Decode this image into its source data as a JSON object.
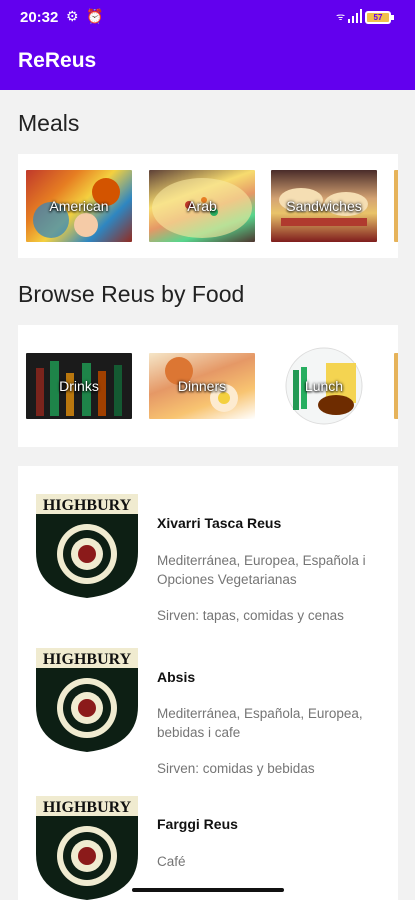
{
  "status_bar": {
    "time": "20:32",
    "icons": [
      "settings-gear-icon",
      "alarm-icon",
      "wifi-icon",
      "signal-icon"
    ],
    "battery": "57"
  },
  "app_bar": {
    "title": "ReReus"
  },
  "meals": {
    "title": "Meals",
    "items": [
      {
        "label": "American",
        "image": "american-food-photo"
      },
      {
        "label": "Arab",
        "image": "arab-rice-dish-photo"
      },
      {
        "label": "Sandwiches",
        "image": "sandwiches-photo"
      }
    ]
  },
  "browse": {
    "title": "Browse Reus by Food",
    "items": [
      {
        "label": "Drinks",
        "image": "drink-bottles-photo"
      },
      {
        "label": "Dinners",
        "image": "dinner-table-photo"
      },
      {
        "label": "Lunch",
        "image": "lunch-plate-photo"
      }
    ]
  },
  "restaurants": [
    {
      "name": "Xivarri Tasca Reus",
      "cuisine": "Mediterránea, Europea, Española i Opciones Vegetarianas",
      "serve": "Sirven: tapas, comidas y cenas",
      "logo_text": "HIGHBURY"
    },
    {
      "name": "Absis",
      "cuisine": "Mediterránea, Española, Europea, bebidas i cafe",
      "serve": "Sirven: comidas y bebidas",
      "logo_text": "HIGHBURY"
    },
    {
      "name": "Farggi Reus",
      "cuisine": "Café",
      "serve": "",
      "logo_text": "HIGHBURY"
    }
  ],
  "colors": {
    "primary": "#6200ee",
    "surface": "#ffffff",
    "background": "#f2f2f2",
    "secondary_text": "#757575"
  }
}
